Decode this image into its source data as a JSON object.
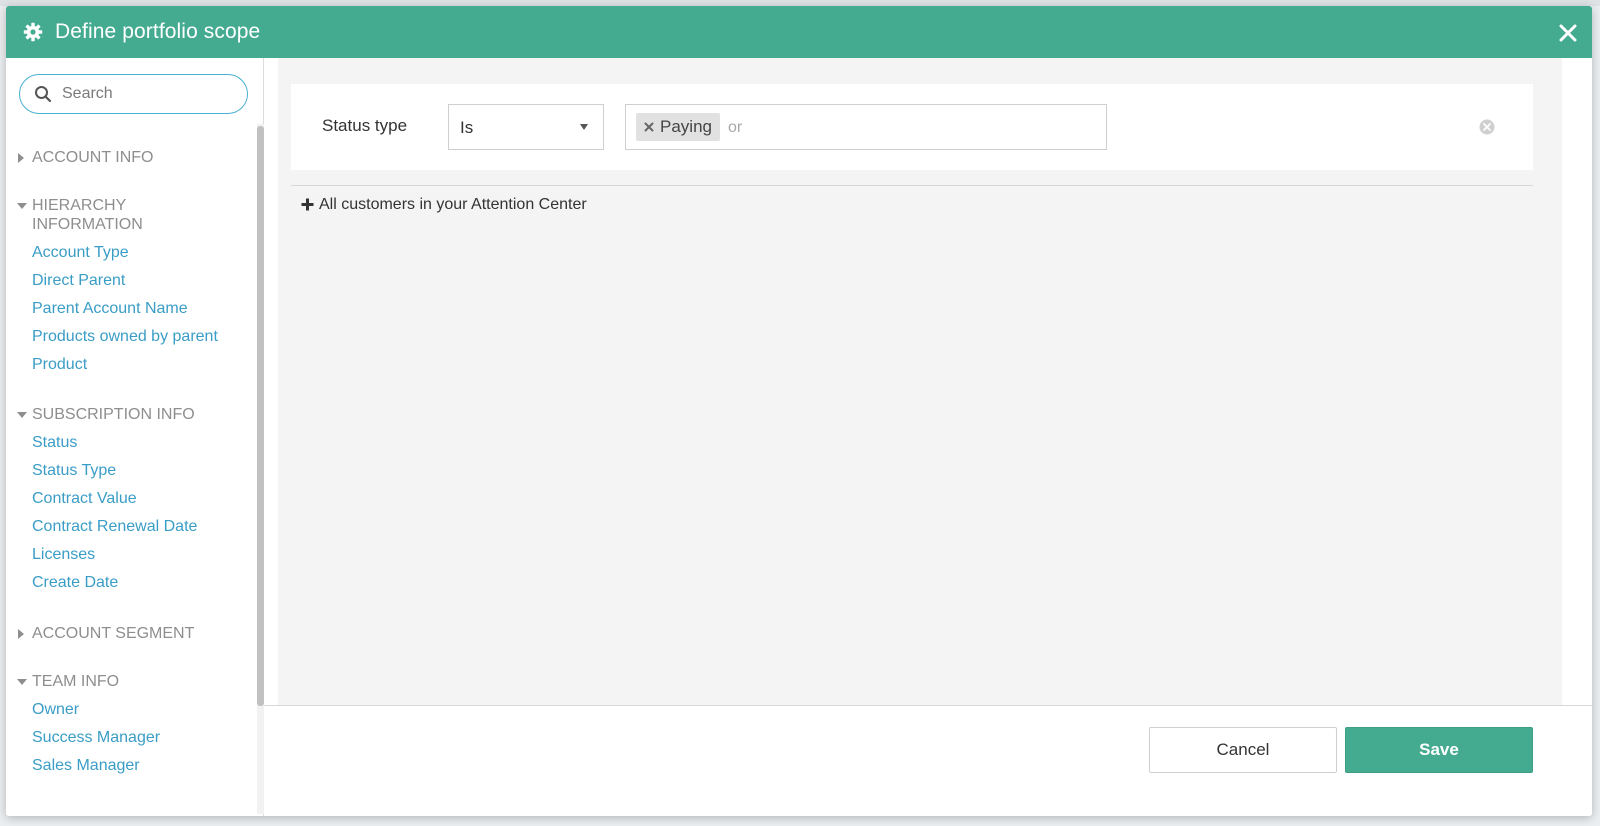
{
  "modal": {
    "title": "Define portfolio scope",
    "header_color": "#44ab91",
    "icon": "gear-icon",
    "close_icon": "close-icon"
  },
  "sidebar": {
    "search_placeholder": "Search",
    "groups": [
      {
        "label": "ACCOUNT INFO",
        "expanded": false,
        "items": []
      },
      {
        "label": "HIERARCHY INFORMATION",
        "expanded": true,
        "items": [
          "Account Type",
          "Direct Parent",
          "Parent Account Name",
          "Products owned by parent",
          "Product"
        ]
      },
      {
        "label": "SUBSCRIPTION INFO",
        "expanded": true,
        "items": [
          "Status",
          "Status Type",
          "Contract Value",
          "Contract Renewal Date",
          "Licenses",
          "Create Date"
        ]
      },
      {
        "label": "ACCOUNT SEGMENT",
        "expanded": false,
        "items": []
      },
      {
        "label": "TEAM INFO",
        "expanded": true,
        "items": [
          "Owner",
          "Success Manager",
          "Sales Manager"
        ]
      }
    ],
    "link_color": "#3a9dc6"
  },
  "rule": {
    "field_label": "Status type",
    "operator": "Is",
    "values": [
      "Paying"
    ],
    "or_placeholder": "or"
  },
  "add_rule_label": "All customers in your Attention Center",
  "footer": {
    "cancel_label": "Cancel",
    "save_label": "Save"
  }
}
